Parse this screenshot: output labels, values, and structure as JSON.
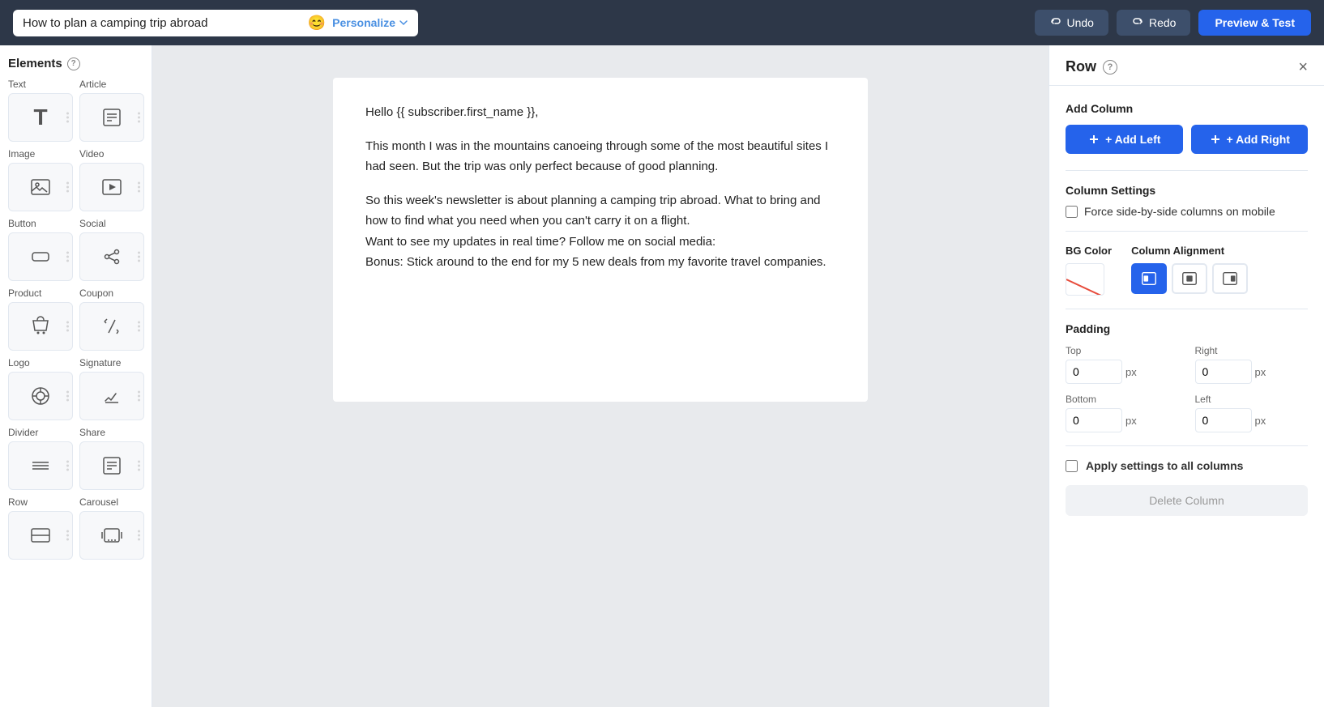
{
  "topbar": {
    "subject": "How to plan a camping trip abroad",
    "emoji_label": "😊",
    "personalize_label": "Personalize",
    "undo_label": "Undo",
    "redo_label": "Redo",
    "preview_label": "Preview & Test"
  },
  "sidebar": {
    "title": "Elements",
    "elements": [
      {
        "id": "text",
        "label": "Text",
        "icon": "T"
      },
      {
        "id": "article",
        "label": "Article",
        "icon": "📰"
      },
      {
        "id": "image",
        "label": "Image",
        "icon": "🖼"
      },
      {
        "id": "video",
        "label": "Video",
        "icon": "▶"
      },
      {
        "id": "button",
        "label": "Button",
        "icon": "⬜"
      },
      {
        "id": "social",
        "label": "Social",
        "icon": "⇄"
      },
      {
        "id": "product",
        "label": "Product",
        "icon": "🛒"
      },
      {
        "id": "coupon",
        "label": "Coupon",
        "icon": "✂"
      },
      {
        "id": "logo",
        "label": "Logo",
        "icon": "⊙"
      },
      {
        "id": "signature",
        "label": "Signature",
        "icon": "✏"
      },
      {
        "id": "divider",
        "label": "Divider",
        "icon": "☰"
      },
      {
        "id": "share",
        "label": "Share",
        "icon": "📰"
      },
      {
        "id": "row",
        "label": "Row",
        "icon": "☰"
      },
      {
        "id": "carousel",
        "label": "Carousel",
        "icon": "🖼"
      }
    ]
  },
  "canvas": {
    "email_content": [
      "Hello {{ subscriber.first_name }},",
      "This month I was in the mountains canoeing through some of the most beautiful sites I had seen. But the trip was only perfect because of good planning.",
      "So this week's newsletter is about planning a camping trip abroad. What to bring and how to find what you need when you can't carry it on a flight.\nWant to see my updates in real time? Follow me on social media:\nBonus: Stick around to the end for my 5 new deals from my favorite travel companies."
    ]
  },
  "panel": {
    "title": "Row",
    "add_column_section": "Add Column",
    "add_left_label": "+ Add Left",
    "add_right_label": "+ Add Right",
    "column_settings_label": "Column Settings",
    "force_mobile_label": "Force side-by-side columns on mobile",
    "bg_color_label": "BG Color",
    "column_alignment_label": "Column Alignment",
    "alignment_options": [
      "left",
      "center",
      "right"
    ],
    "padding_label": "Padding",
    "top_label": "Top",
    "right_label": "Right",
    "bottom_label": "Bottom",
    "left_label": "Left",
    "top_value": "0",
    "right_value": "0",
    "bottom_value": "0",
    "left_value": "0",
    "px_unit": "px",
    "apply_settings_label": "Apply settings to all columns",
    "delete_column_label": "Delete Column"
  }
}
